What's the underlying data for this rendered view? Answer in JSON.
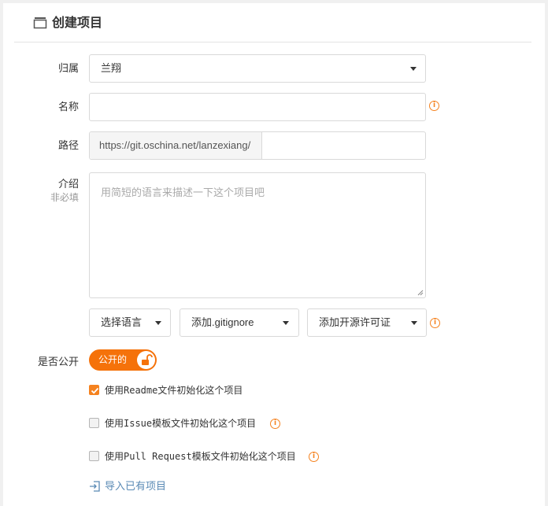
{
  "header": {
    "title": "创建项目",
    "icon": "folder-icon"
  },
  "form": {
    "owner": {
      "label": "归属",
      "value": "兰翔"
    },
    "name": {
      "label": "名称",
      "value": "",
      "info_icon": "info-icon"
    },
    "path": {
      "label": "路径",
      "prefix": "https://git.oschina.net/lanzexiang/",
      "value": ""
    },
    "intro": {
      "label": "介绍",
      "sublabel": "非必填",
      "placeholder": "用简短的语言来描述一下这个项目吧"
    },
    "selects": {
      "language": "选择语言",
      "gitignore": "添加.gitignore",
      "license": "添加开源许可证"
    },
    "visibility": {
      "label": "是否公开",
      "toggle_label": "公开的",
      "toggle_icon": "unlock-icon",
      "on": true
    },
    "options": [
      {
        "label": "使用Readme文件初始化这个项目",
        "checked": true,
        "has_info": false
      },
      {
        "label": "使用Issue模板文件初始化这个项目",
        "checked": false,
        "has_info": true
      },
      {
        "label": "使用Pull Request模板文件初始化这个项目",
        "checked": false,
        "has_info": true
      }
    ],
    "import_link": "导入已有项目"
  },
  "colors": {
    "accent": "#f5720a",
    "info": "#f5821f",
    "link": "#5a8ab5"
  }
}
